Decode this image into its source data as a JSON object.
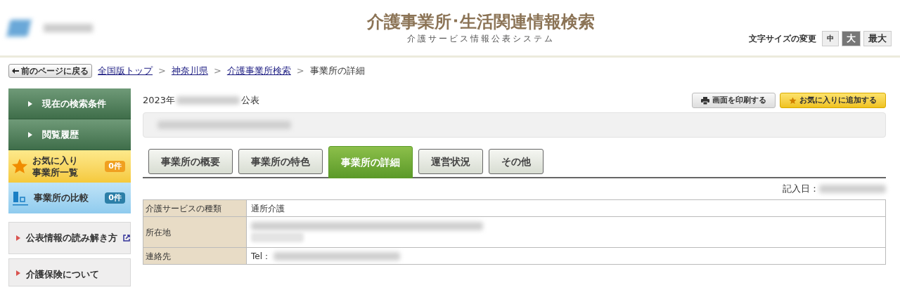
{
  "header": {
    "title": "介護事業所･生活関連情報検索",
    "subtitle": "介護サービス情報公表システム",
    "font_size": {
      "label": "文字サイズの変更",
      "options": [
        {
          "label": "中",
          "selected": false
        },
        {
          "label": "大",
          "selected": true
        },
        {
          "label": "最大",
          "selected": false
        }
      ]
    }
  },
  "breadcrumb": {
    "back": "前のページに戻る",
    "items": [
      {
        "label": "全国版トップ",
        "kind": "link"
      },
      {
        "label": "神奈川県",
        "kind": "link"
      },
      {
        "label": "介護事業所検索",
        "kind": "link"
      },
      {
        "label": "事業所の詳細",
        "kind": "current"
      }
    ],
    "separator": ">"
  },
  "sidebar": {
    "items": [
      {
        "label": "現在の検索条件",
        "kind": "panel"
      },
      {
        "label": "閲覧履歴",
        "kind": "panel"
      },
      {
        "label": "お気に入り事業所一覧",
        "kind": "favorite",
        "count": "0件"
      },
      {
        "label": "事業所の比較",
        "kind": "compare",
        "count": "0件"
      },
      {
        "label": "公表情報の読み解き方",
        "kind": "external"
      },
      {
        "label": "介護保険について",
        "kind": "link"
      }
    ]
  },
  "main": {
    "published": {
      "prefix": "2023年",
      "suffix": "公表"
    },
    "buttons": [
      {
        "label": "画面を印刷する",
        "kind": "print"
      },
      {
        "label": "お気に入りに追加する",
        "kind": "favorite"
      }
    ],
    "tabs": [
      {
        "label": "事業所の概要",
        "selected": false
      },
      {
        "label": "事業所の特色",
        "selected": false
      },
      {
        "label": "事業所の詳細",
        "selected": true
      },
      {
        "label": "運営状況",
        "selected": false
      },
      {
        "label": "その他",
        "selected": false
      }
    ],
    "entry_date_label": "記入日：",
    "table": {
      "rows": [
        {
          "label": "介護サービスの種類",
          "value": "通所介護"
        },
        {
          "label": "所在地",
          "kind": "address"
        },
        {
          "label": "連絡先",
          "value": "Tel："
        }
      ]
    }
  }
}
